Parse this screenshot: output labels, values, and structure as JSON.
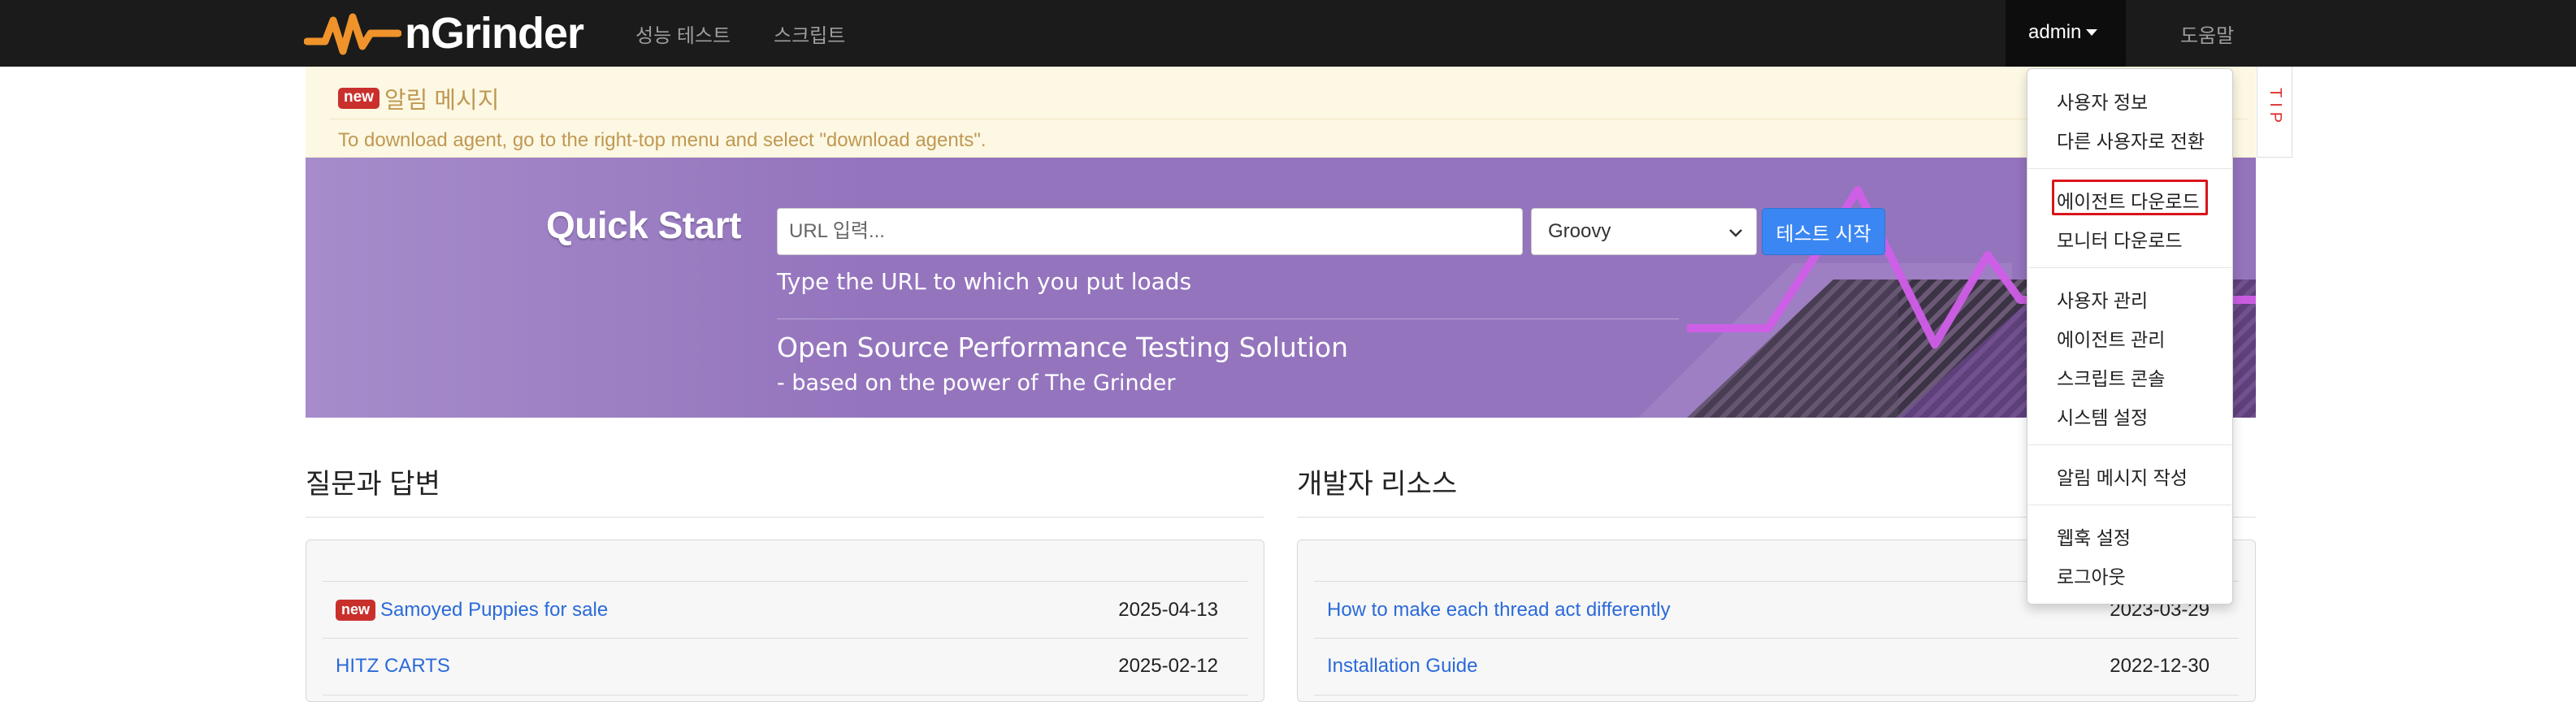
{
  "navbar": {
    "brand": "nGrinder",
    "links": {
      "perf_test": "성능 테스트",
      "script": "스크립트"
    },
    "user": "admin",
    "help": "도움말"
  },
  "notice": {
    "badge": "new",
    "title": "알림 메시지",
    "text": "To download agent, go to the right-top menu and select \"download agents\"."
  },
  "tip": "TIP",
  "quick_start": {
    "title": "Quick Start",
    "url_placeholder": "URL 입력...",
    "language": "Groovy",
    "start_button": "테스트 시작",
    "hint": "Type the URL to which you put loads",
    "slogan": "Open Source Performance Testing Solution",
    "subslogan": "- based on the power of The Grinder"
  },
  "qna": {
    "title": "질문과 답변",
    "items": [
      {
        "badge": "new",
        "title": "Samoyed Puppies for sale",
        "date": "2025-04-13"
      },
      {
        "badge": "",
        "title": "HITZ CARTS",
        "date": "2025-02-12"
      }
    ]
  },
  "dev_resources": {
    "title": "개발자 리소스",
    "items": [
      {
        "title": "How to make each thread act differently",
        "date": "2023-03-29"
      },
      {
        "title": "Installation Guide",
        "date": "2022-12-30"
      }
    ]
  },
  "user_menu": {
    "items": [
      "사용자 정보",
      "다른 사용자로 전환",
      "에이전트 다운로드",
      "모니터 다운로드",
      "사용자 관리",
      "에이전트 관리",
      "스크립트 콘솔",
      "시스템 설정",
      "알림 메시지 작성",
      "웹훅 설정",
      "로그아웃"
    ]
  },
  "colors": {
    "navbar": "#1b1b1b",
    "brand_orange": "#f0932b",
    "quick_start_bg": "#9474bd",
    "primary_button": "#3a86f2",
    "link": "#2a6ad9",
    "badge": "#c9302c",
    "highlight": "#d9141b"
  }
}
